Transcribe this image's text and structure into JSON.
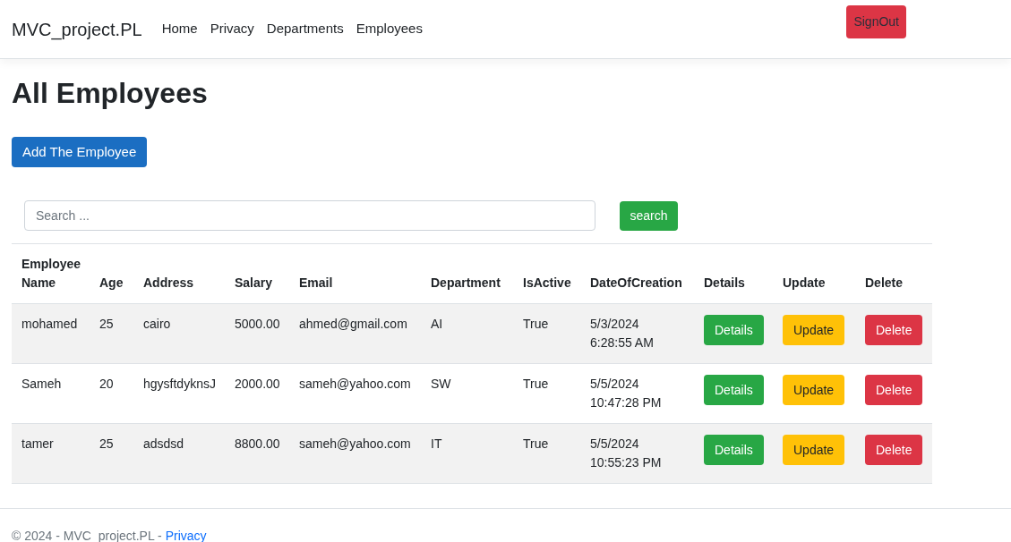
{
  "navbar": {
    "brand": "MVC_project.PL",
    "links": [
      "Home",
      "Privacy",
      "Departments",
      "Employees"
    ],
    "signout_button": "SignOut"
  },
  "page_title": "All Employees",
  "add_button": "Add The Employee",
  "search": {
    "placeholder": "Search ...",
    "button": "search"
  },
  "table": {
    "columns": [
      "Employee Name",
      "Age",
      "Address",
      "Salary",
      "Email",
      "Department",
      "IsActive",
      "DateOfCreation",
      "Details",
      "Update",
      "Delete"
    ],
    "rows": [
      {
        "cells": [
          "mohamed",
          "25",
          "cairo",
          "5000.00",
          "ahmed@gmail.com",
          "AI",
          "True",
          "5/3/2024 6:28:55 AM"
        ],
        "actions": [
          {
            "kind": "details",
            "label": "Details"
          },
          {
            "kind": "update",
            "label": "Update"
          },
          {
            "kind": "delete",
            "label": "Delete"
          }
        ]
      },
      {
        "cells": [
          "Sameh",
          "20",
          "hgysftdyknsJ",
          "2000.00",
          "sameh@yahoo.com",
          "SW",
          "True",
          "5/5/2024 10:47:28 PM"
        ],
        "actions": [
          {
            "kind": "details",
            "label": "Details"
          },
          {
            "kind": "update",
            "label": "Update"
          },
          {
            "kind": "delete",
            "label": "Delete"
          }
        ]
      },
      {
        "cells": [
          "tamer",
          "25",
          "adsdsd",
          "8800.00",
          "sameh@yahoo.com",
          "IT",
          "True",
          "5/5/2024 10:55:23 PM"
        ],
        "actions": [
          {
            "kind": "details",
            "label": "Details"
          },
          {
            "kind": "update",
            "label": "Update"
          },
          {
            "kind": "delete",
            "label": "Delete"
          }
        ]
      }
    ]
  },
  "footer": {
    "text": "© 2024 - MVC_project.PL - ",
    "link": "Privacy"
  }
}
